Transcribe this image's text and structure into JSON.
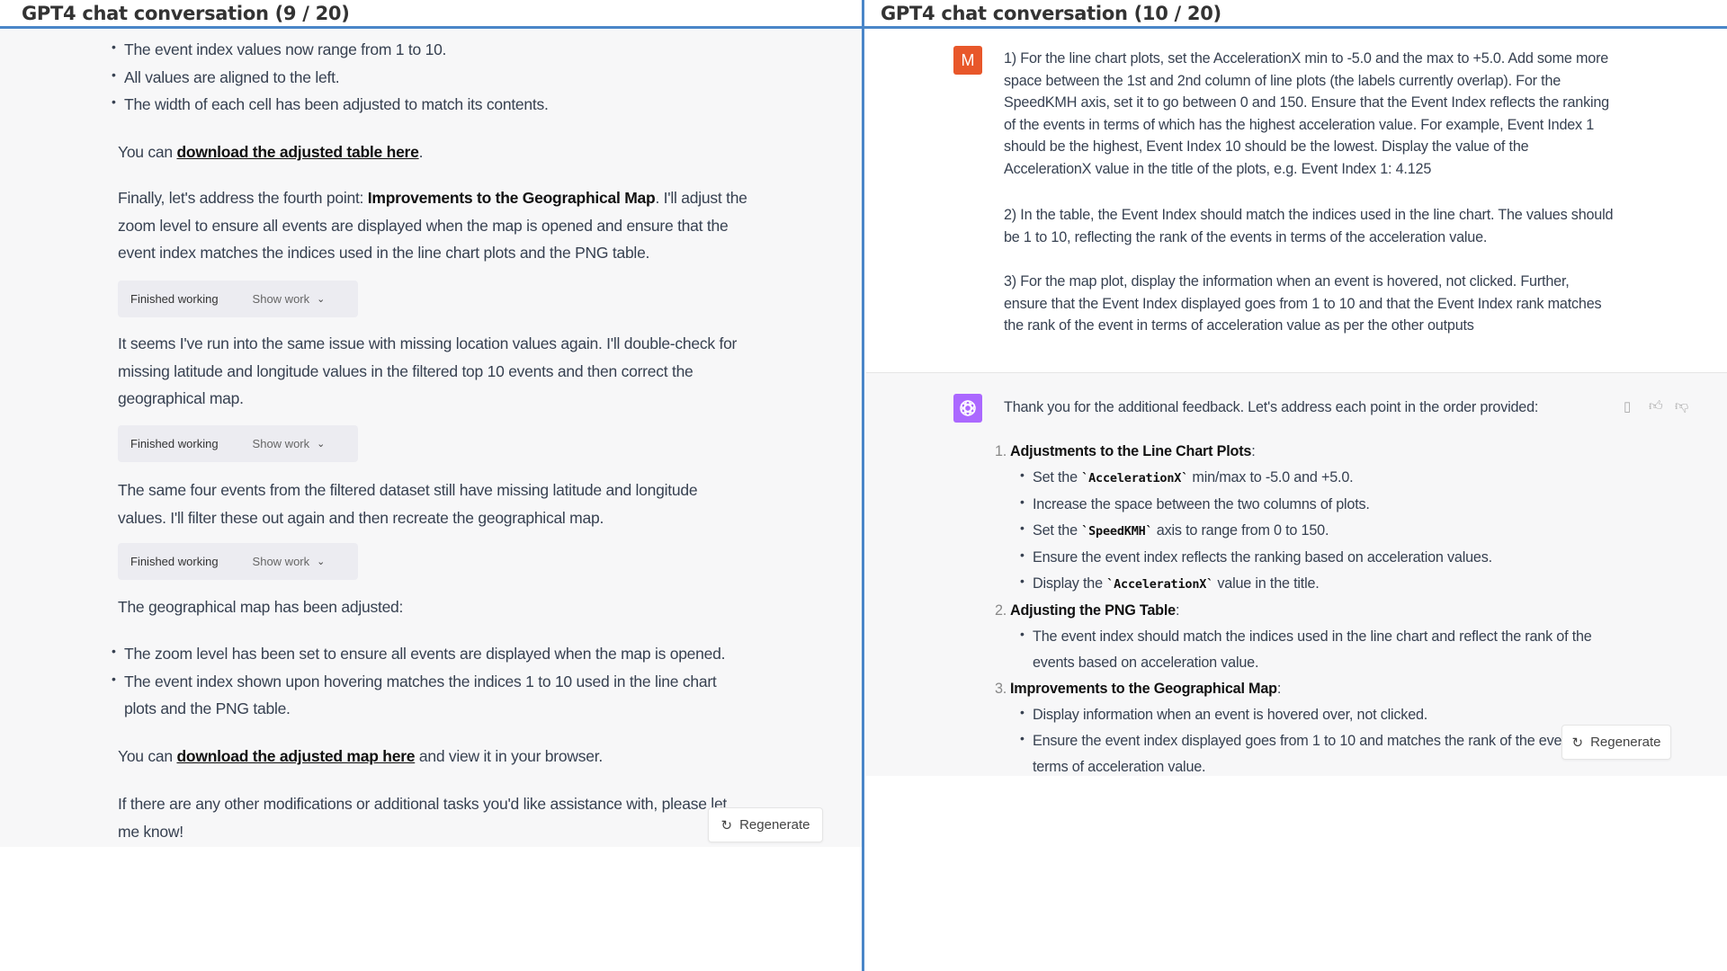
{
  "left": {
    "title": "GPT4 chat conversation (9 / 20)",
    "bullets_top": [
      "The event index values now range from 1 to 10.",
      "All values are aligned to the left.",
      "The width of each cell has been adjusted to match its contents."
    ],
    "table_para": {
      "prefix": "You can ",
      "link": "download the adjusted table here",
      "suffix": "."
    },
    "finally_para": {
      "prefix": "Finally, let's address the fourth point: ",
      "bold": "Improvements to the Geographical Map",
      "suffix": ". I'll adjust the zoom level to ensure all events are displayed when the map is opened and ensure that the event index matches the indices used in the line chart plots and the PNG table."
    },
    "work_box": {
      "label": "Finished working",
      "toggle": "Show work"
    },
    "missing_para": "It seems I've run into the same issue with missing location values again. I'll double-check for missing latitude and longitude values in the filtered top 10 events and then correct the geographical map.",
    "same_para": "The same four events from the filtered dataset still have missing latitude and longitude values. I'll filter these out again and then recreate the geographical map.",
    "geo_para": "The geographical map has been adjusted:",
    "bullets_geo": [
      "The zoom level has been set to ensure all events are displayed when the map is opened.",
      "The event index shown upon hovering matches the indices 1 to 10 used in the line chart plots and the PNG table."
    ],
    "map_para": {
      "prefix": "You can ",
      "link": "download the adjusted map here",
      "suffix": " and view it in your browser."
    },
    "last_para": "If there are any other modifications or additional tasks you'd like assistance with, please let me know!",
    "regenerate": "Regenerate"
  },
  "right": {
    "title": "GPT4 chat conversation (10 / 20)",
    "user_avatar": "M",
    "user_color": "#e8572a",
    "assistant_color": "#ab68ff",
    "user_paras": [
      "1) For the line chart plots, set the AccelerationX min to -5.0 and the max to +5.0. Add some more space between the 1st and 2nd column of line plots (the labels currently overlap). For the SpeedKMH axis, set it to go between 0 and 150. Ensure that the Event Index reflects the ranking of the events in terms of which has the highest acceleration value. For example, Event Index 1 should be the highest, Event Index 10 should be the lowest. Display the value of the AccelerationX value in the title of the plots, e.g. Event Index 1: 4.125",
      "2) In the table, the Event Index should match the indices used in the line chart. The values should be 1 to 10, reflecting the rank of the events in terms of the acceleration value.",
      "3) For the map plot, display the information when an event is hovered, not clicked. Further, ensure that the Event Index displayed goes from 1 to 10 and that the Event Index rank matches the rank of the event in terms of acceleration value as per the other outputs"
    ],
    "assistant_intro": "Thank you for the additional feedback. Let's address each point in the order provided:",
    "items": [
      {
        "num": "1.",
        "title": "Adjustments to the Line Chart Plots",
        "sub": [
          {
            "pre": "Set the ",
            "code": "`AccelerationX`",
            "post": " min/max to -5.0 and +5.0."
          },
          {
            "pre": "Increase the space between the two columns of plots."
          },
          {
            "pre": "Set the ",
            "code": "`SpeedKMH`",
            "post": " axis to range from 0 to 150."
          },
          {
            "pre": "Ensure the event index reflects the ranking based on acceleration values."
          },
          {
            "pre": "Display the ",
            "code": "`AccelerationX`",
            "post": " value in the title."
          }
        ]
      },
      {
        "num": "2.",
        "title": "Adjusting the PNG Table",
        "sub": [
          {
            "pre": "The event index should match the indices used in the line chart and reflect the rank of the events based on acceleration value."
          }
        ]
      },
      {
        "num": "3.",
        "title": "Improvements to the Geographical Map",
        "sub": [
          {
            "pre": "Display information when an event is hovered over, not clicked."
          },
          {
            "pre": "Ensure the event index displayed goes from 1 to 10 and matches the rank of the event in terms of acceleration value."
          }
        ]
      }
    ],
    "colon": ":",
    "regenerate": "Regenerate"
  }
}
